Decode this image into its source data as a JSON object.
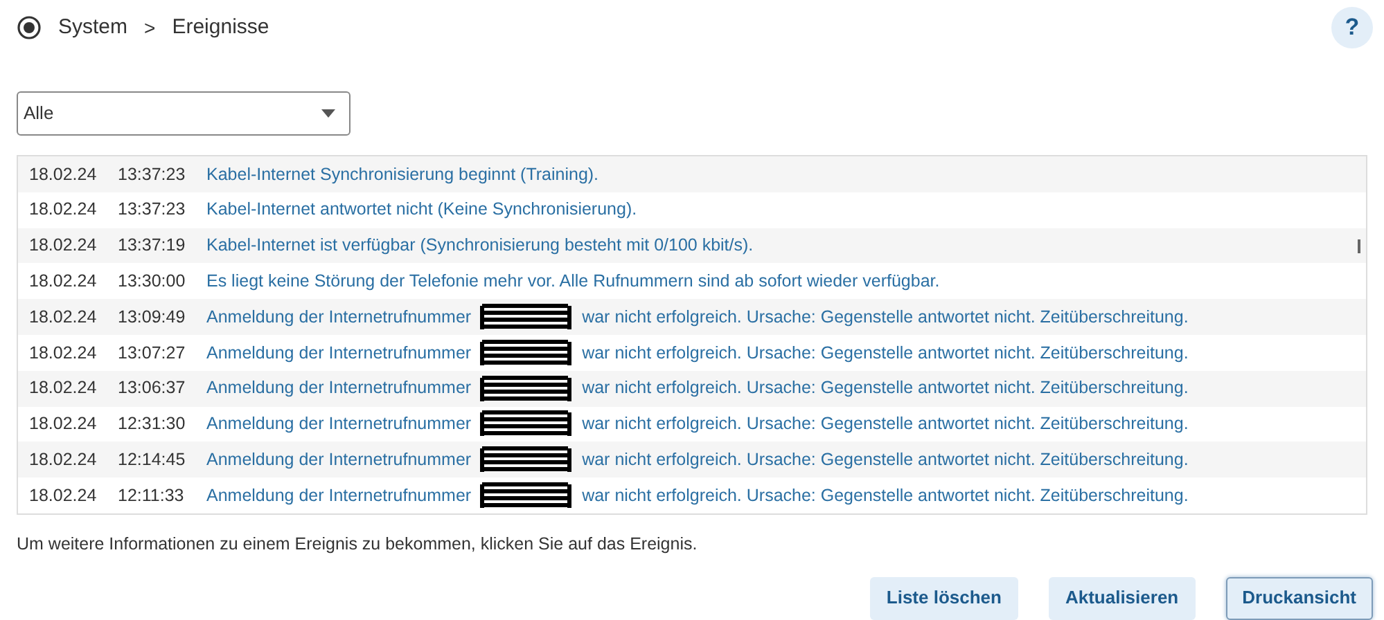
{
  "breadcrumb": {
    "section": "System",
    "separator": ">",
    "page": "Ereignisse"
  },
  "help_button": {
    "label": "?"
  },
  "filter": {
    "value": "Alle"
  },
  "events": [
    {
      "date": "18.02.24",
      "time": "13:37:23",
      "kind": "plain",
      "message": "Kabel-Internet Synchronisierung beginnt (Training)."
    },
    {
      "date": "18.02.24",
      "time": "13:37:23",
      "kind": "plain",
      "message": "Kabel-Internet antwortet nicht (Keine Synchronisierung)."
    },
    {
      "date": "18.02.24",
      "time": "13:37:19",
      "kind": "plain",
      "message": "Kabel-Internet ist verfügbar (Synchronisierung besteht mit 0/100 kbit/s)."
    },
    {
      "date": "18.02.24",
      "time": "13:30:00",
      "kind": "plain",
      "message": "Es liegt keine Störung der Telefonie mehr vor. Alle Rufnummern sind ab sofort wieder verfügbar."
    },
    {
      "date": "18.02.24",
      "time": "13:09:49",
      "kind": "redacted",
      "message": "Anmeldung der Internetrufnummer",
      "message_after": "war nicht erfolgreich. Ursache: Gegenstelle antwortet nicht. Zeitüberschreitung."
    },
    {
      "date": "18.02.24",
      "time": "13:07:27",
      "kind": "redacted",
      "message": "Anmeldung der Internetrufnummer",
      "message_after": "war nicht erfolgreich. Ursache: Gegenstelle antwortet nicht. Zeitüberschreitung."
    },
    {
      "date": "18.02.24",
      "time": "13:06:37",
      "kind": "redacted",
      "message": "Anmeldung der Internetrufnummer",
      "message_after": "war nicht erfolgreich. Ursache: Gegenstelle antwortet nicht. Zeitüberschreitung."
    },
    {
      "date": "18.02.24",
      "time": "12:31:30",
      "kind": "redacted",
      "message": "Anmeldung der Internetrufnummer",
      "message_after": "war nicht erfolgreich. Ursache: Gegenstelle antwortet nicht. Zeitüberschreitung."
    },
    {
      "date": "18.02.24",
      "time": "12:14:45",
      "kind": "redacted",
      "message": "Anmeldung der Internetrufnummer",
      "message_after": "war nicht erfolgreich. Ursache: Gegenstelle antwortet nicht. Zeitüberschreitung."
    },
    {
      "date": "18.02.24",
      "time": "12:11:33",
      "kind": "redacted",
      "message": "Anmeldung der Internetrufnummer",
      "message_after": "war nicht erfolgreich. Ursache: Gegenstelle antwortet nicht. Zeitüberschreitung."
    }
  ],
  "hint": "Um weitere Informationen zu einem Ereignis zu bekommen, klicken Sie auf das Ereignis.",
  "buttons": [
    {
      "label": "Liste löschen",
      "focused": false
    },
    {
      "label": "Aktualisieren",
      "focused": false
    },
    {
      "label": "Druckansicht",
      "focused": true
    }
  ]
}
